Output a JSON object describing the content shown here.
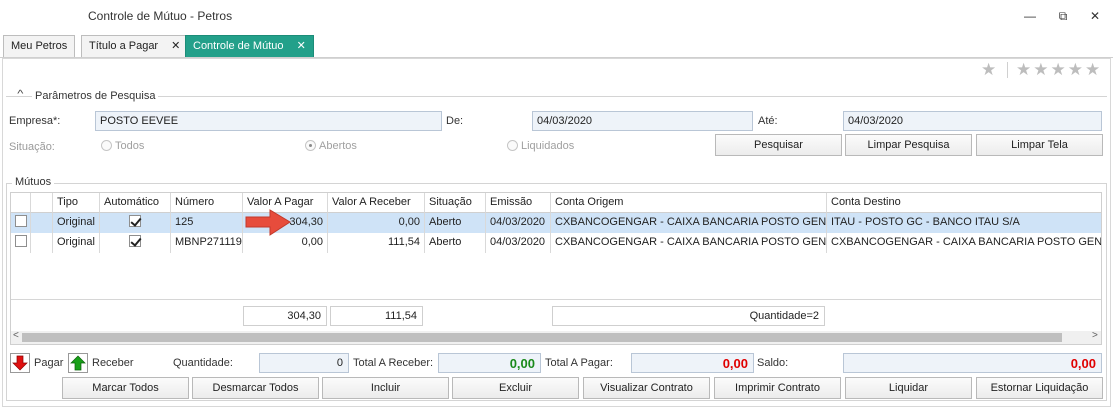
{
  "window": {
    "title": "Controle de Mútuo - Petros",
    "minimize": "—",
    "restore": "⧉",
    "close": "✕"
  },
  "tabs": [
    {
      "label": "Meu Petros",
      "closable": false
    },
    {
      "label": "Título a Pagar",
      "closable": true
    },
    {
      "label": "Controle de Mútuo",
      "closable": true,
      "active": true
    }
  ],
  "tab_close_glyph": "✕",
  "rating": {
    "favorite": "★",
    "stars": "★★★★★"
  },
  "search": {
    "group_title": "Parâmetros de Pesquisa",
    "collapse_glyph": "^",
    "empresa_label": "Empresa*:",
    "empresa_value": "POSTO EEVEE",
    "de_label": "De:",
    "de_value": "04/03/2020",
    "ate_label": "Até:",
    "ate_value": "04/03/2020",
    "situacao_label": "Situação:",
    "situacao_options": [
      "Todos",
      "Abertos",
      "Liquidados"
    ],
    "situacao_selected": "Abertos",
    "buttons": {
      "pesquisar": "Pesquisar",
      "limpar_pesquisa": "Limpar Pesquisa",
      "limpar_tela": "Limpar Tela"
    }
  },
  "mutuos": {
    "group_title": "Mútuos",
    "columns": [
      "Tipo",
      "Automático",
      "Número",
      "Valor A Pagar",
      "Valor A Receber",
      "Situação",
      "Emissão",
      "Conta Origem",
      "Conta Destino"
    ],
    "rows": [
      {
        "selected": false,
        "tipo": "Original",
        "automatico": true,
        "numero": "125",
        "valor_pagar": "304,30",
        "valor_receber": "0,00",
        "situacao": "Aberto",
        "emissao": "04/03/2020",
        "conta_origem": "CXBANCOGENGAR - CAIXA BANCARIA POSTO GENGAR",
        "conta_destino": "ITAU - POSTO GC - BANCO ITAU S/A",
        "highlighted": true
      },
      {
        "selected": false,
        "tipo": "Original",
        "automatico": true,
        "numero": "MBNP271119",
        "valor_pagar": "0,00",
        "valor_receber": "111,54",
        "situacao": "Aberto",
        "emissao": "04/03/2020",
        "conta_origem": "CXBANCOGENGAR - CAIXA BANCARIA POSTO GENGAR",
        "conta_destino": "CXBANCOGENGAR - CAIXA BANCARIA POSTO GENGAR",
        "highlighted": false
      }
    ],
    "footer": {
      "total_pagar": "304,30",
      "total_receber": "111,54",
      "quantidade": "Quantidade=2"
    }
  },
  "legend": {
    "pagar": "Pagar",
    "receber": "Receber"
  },
  "summary": {
    "quantidade_label": "Quantidade:",
    "quantidade_value": "0",
    "total_receber_label": "Total A Receber:",
    "total_receber_value": "0,00",
    "total_pagar_label": "Total A Pagar:",
    "total_pagar_value": "0,00",
    "saldo_label": "Saldo:",
    "saldo_value": "0,00"
  },
  "actions": [
    "Marcar Todos",
    "Desmarcar Todos",
    "Incluir",
    "Excluir",
    "Visualizar Contrato",
    "Imprimir Contrato",
    "Liquidar",
    "Estornar Liquidação"
  ],
  "colors": {
    "tab_active": "#23a08a",
    "row_selected": "#cfe3f7",
    "positive": "#1a8a1a",
    "negative": "#e00000",
    "arrow_pointer": "#e74c3c"
  }
}
